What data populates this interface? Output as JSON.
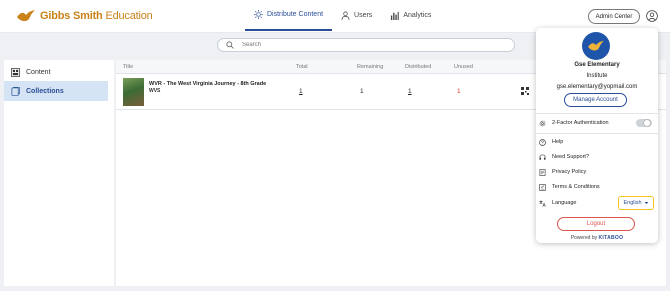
{
  "brand": {
    "name_bold": "Gibbs Smith",
    "name_thin": " Education",
    "color": "#c9831a"
  },
  "nav": {
    "items": [
      {
        "label": "Distribute Content",
        "icon": "sun-icon",
        "active": true
      },
      {
        "label": "Users",
        "icon": "user-icon",
        "active": false
      },
      {
        "label": "Analytics",
        "icon": "bar-chart-icon",
        "active": false
      }
    ]
  },
  "header": {
    "admin_center_label": "Admin Center",
    "profile_icon": "user-circle-icon"
  },
  "search": {
    "placeholder": "Search"
  },
  "sidebar": {
    "items": [
      {
        "label": "Content",
        "icon": "grid-icon",
        "active": false
      },
      {
        "label": "Collections",
        "icon": "folder-icon",
        "active": true
      }
    ]
  },
  "table": {
    "columns": [
      "Title",
      "Total",
      "Remaining",
      "Distributed",
      "Unused"
    ],
    "rows": [
      {
        "title": "WVR - The West Virginia Journey - 8th Grade",
        "code": "WVS",
        "total": "1",
        "remaining": "1",
        "distributed": "1",
        "unused": "1"
      }
    ]
  },
  "profile": {
    "org_name": "Gse Elementary",
    "role": "Institute",
    "email": "gse.elementary@yopmail.com",
    "manage_label": "Manage Account",
    "two_factor_label": "2-Factor Authentication",
    "two_factor_enabled": false,
    "menu": [
      {
        "label": "Help",
        "icon": "help-circle-icon"
      },
      {
        "label": "Need Support?",
        "icon": "headset-icon"
      },
      {
        "label": "Privacy Policy",
        "icon": "document-icon"
      },
      {
        "label": "Terms & Conditions",
        "icon": "terms-icon"
      }
    ],
    "language_label": "Language",
    "language_value": "English",
    "logout_label": "Logout",
    "powered_by_label": "Powered by",
    "powered_by_brand": "KITABOO"
  },
  "colors": {
    "accent": "#2a4e96",
    "logout": "#d9534f",
    "highlight": "#f2c522",
    "active_bg": "#d5e4f5"
  }
}
